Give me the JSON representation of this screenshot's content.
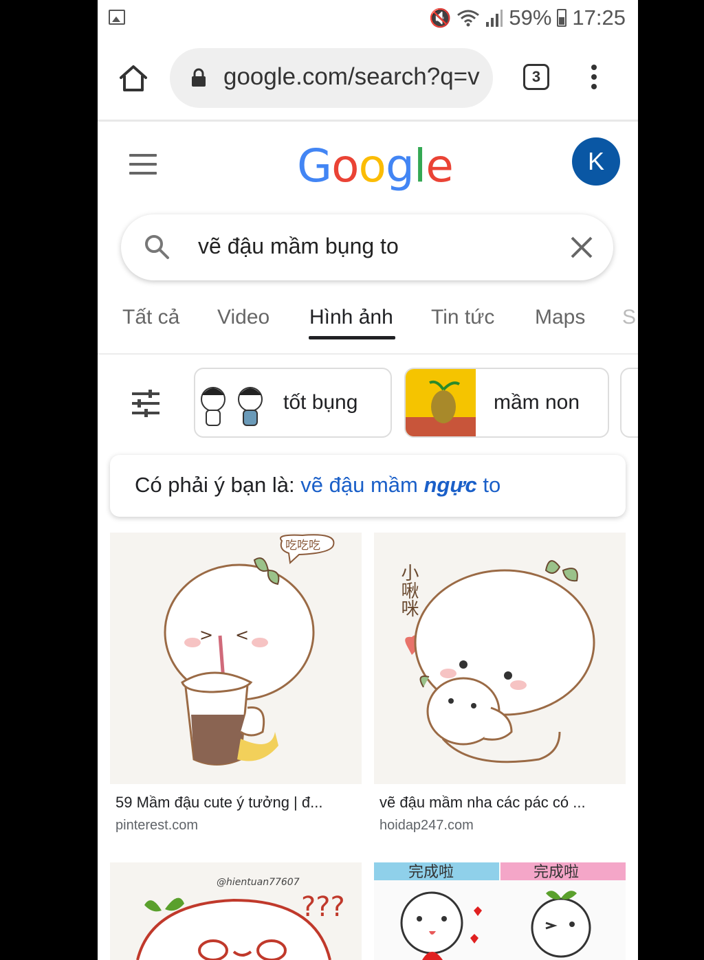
{
  "status_bar": {
    "battery_percent": "59%",
    "time": "17:25"
  },
  "browser": {
    "url": "google.com/search?q=v",
    "tab_count": "3"
  },
  "header": {
    "logo_letters": [
      "G",
      "o",
      "o",
      "g",
      "l",
      "e"
    ],
    "logo_colors": [
      "#4285F4",
      "#EA4335",
      "#FBBC05",
      "#4285F4",
      "#34A853",
      "#EA4335"
    ],
    "avatar_initial": "K"
  },
  "search": {
    "query": "vẽ đậu mầm bụng to"
  },
  "tabs": [
    {
      "label": "Tất cả"
    },
    {
      "label": "Video"
    },
    {
      "label": "Hình ảnh",
      "active": true
    },
    {
      "label": "Tin tức"
    },
    {
      "label": "Maps"
    },
    {
      "label": "S"
    }
  ],
  "chips": [
    {
      "label": "tốt bụng"
    },
    {
      "label": "mầm non"
    }
  ],
  "did_you_mean": {
    "prefix": "Có phải ý bạn là:",
    "suggestion_start": "vẽ đậu mầm",
    "suggestion_bold": "ngực",
    "suggestion_end": "to"
  },
  "results": [
    {
      "title": "59 Mầm đậu cute ý tưởng | đ...",
      "source": "pinterest.com",
      "image_caption": "吃吃吃"
    },
    {
      "title": "vẽ đậu mầm nha các pác có ...",
      "source": "hoidap247.com",
      "image_caption": "小啾咪"
    },
    {
      "title": "",
      "source": "",
      "image_caption": "@hientuan77607"
    },
    {
      "title": "",
      "source": "",
      "image_caption": "完成啦"
    }
  ],
  "colors": {
    "accent_link": "#1a5fc8",
    "avatar_bg": "#0a57a4"
  }
}
